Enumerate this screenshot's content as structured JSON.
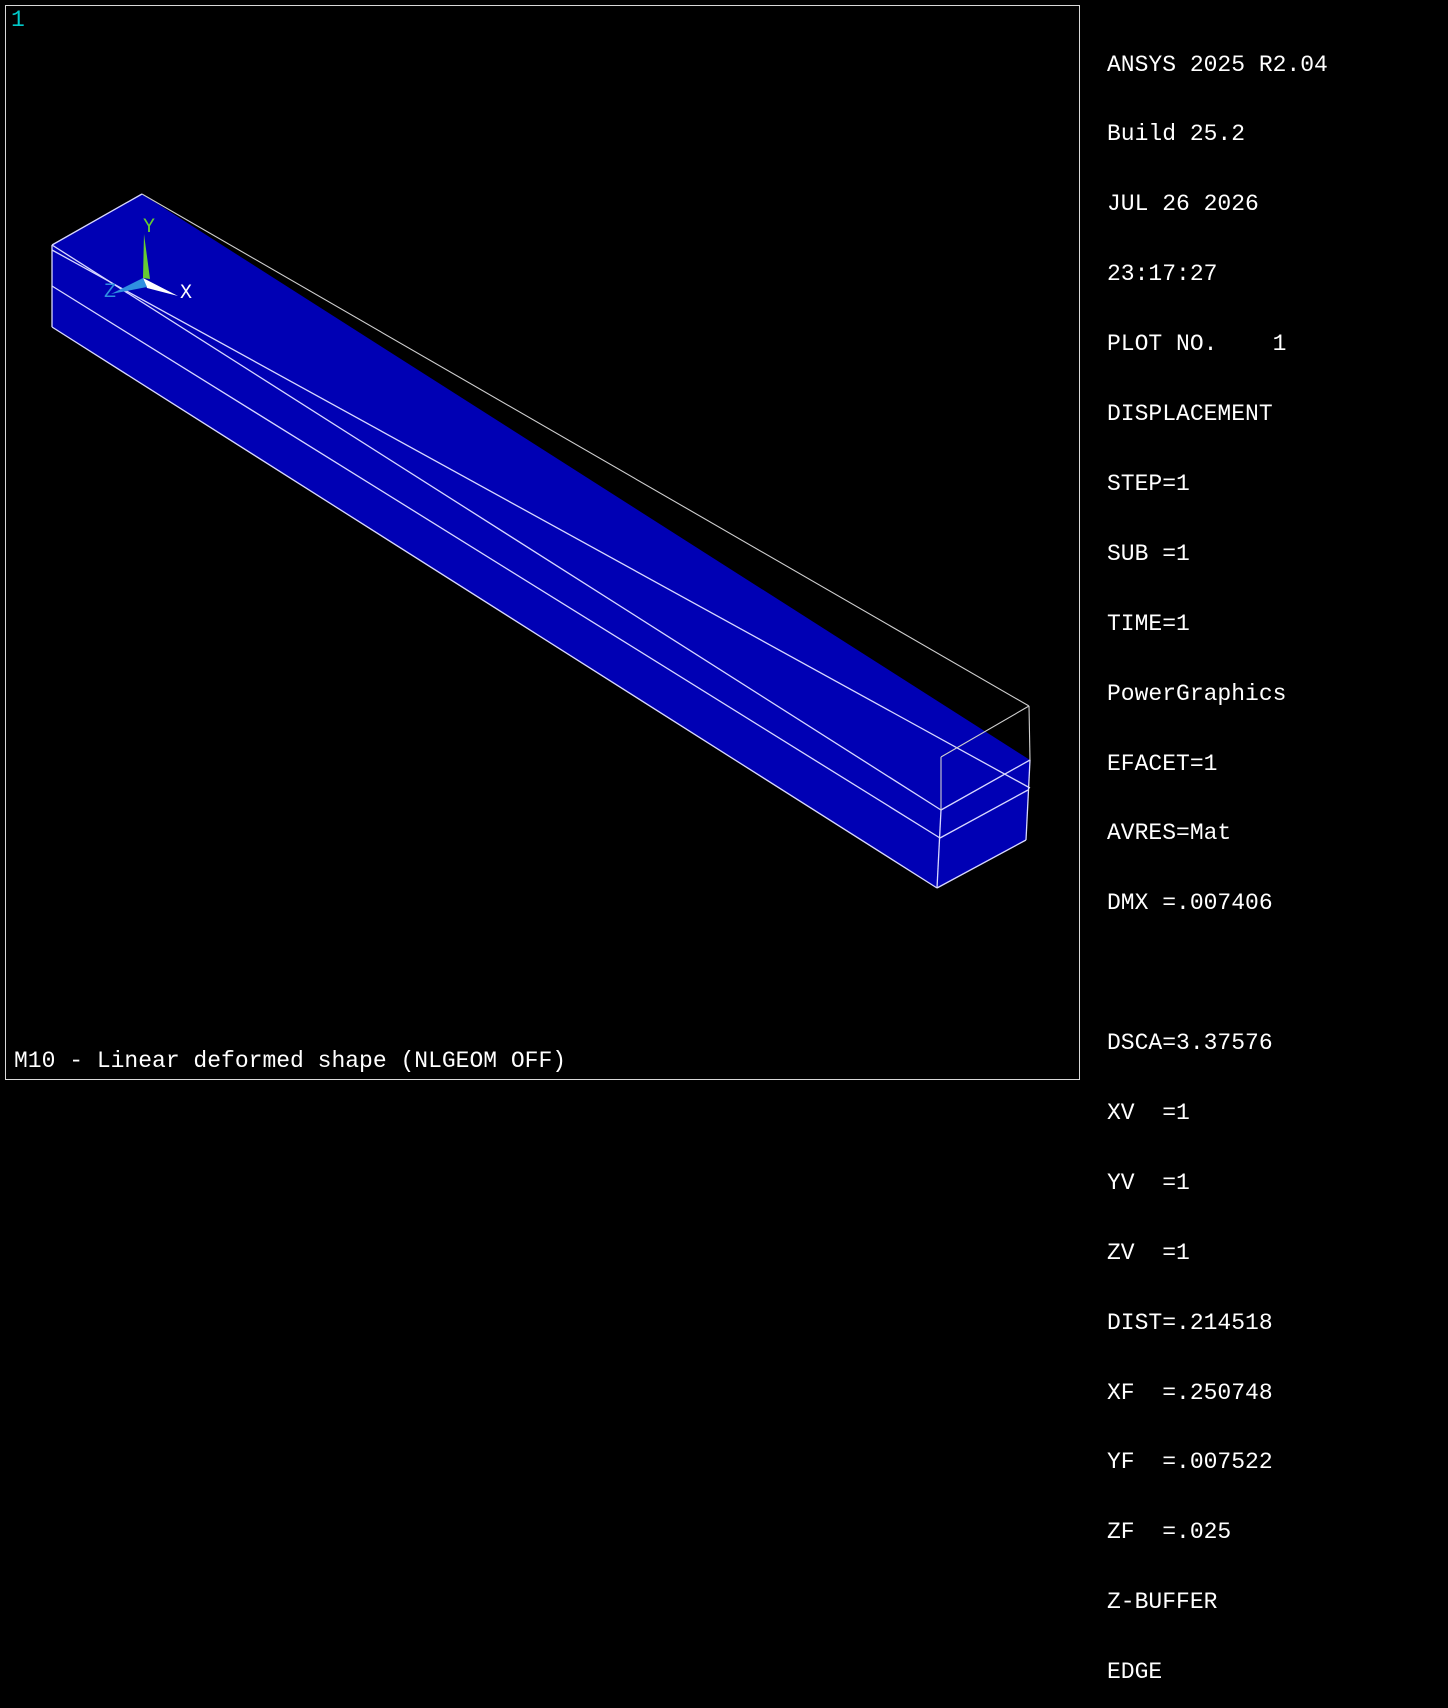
{
  "window": {
    "number": "1"
  },
  "legend": {
    "header": [
      "ANSYS 2025 R2.04",
      "Build 25.2",
      "JUL 26 2026",
      "23:17:27",
      "PLOT NO.    1",
      "DISPLACEMENT",
      "STEP=1",
      "SUB =1",
      "TIME=1",
      "PowerGraphics",
      "EFACET=1",
      "AVRES=Mat",
      "DMX =.007406"
    ],
    "view": [
      "DSCA=3.37576",
      "XV  =1",
      "YV  =1",
      "ZV  =1",
      "DIST=.214518",
      "XF  =.250748",
      "YF  =.007522",
      "ZF  =.025",
      "Z-BUFFER",
      "EDGE"
    ]
  },
  "triad": {
    "x_label": "X",
    "y_label": "Y",
    "z_label": "Z",
    "x_color": "#ffffff",
    "y_color": "#66cc33",
    "z_color": "#2f8fe0"
  },
  "model": {
    "deformed_color": "#0000b4",
    "edge_color": "#d8d8ff",
    "undeformed_edge_color": "#cfcfcf"
  },
  "caption": "M10 - Linear deformed shape (NLGEOM OFF)"
}
